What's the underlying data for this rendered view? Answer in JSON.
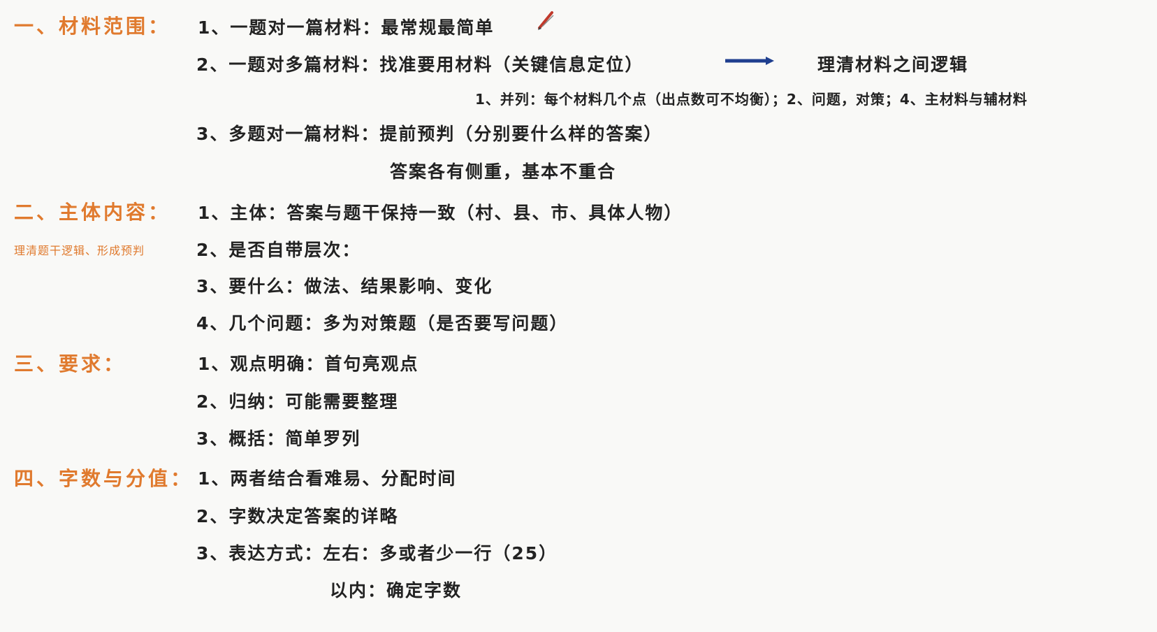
{
  "section1": {
    "heading": "一、材料范围：",
    "item1": "1、一题对一篇材料：最常规最简单",
    "item2": "2、一题对多篇材料：找准要用材料（关键信息定位）",
    "item2_result": "理清材料之间逻辑",
    "item2_sub": "1、并列：每个材料几个点（出点数可不均衡）；2、问题，对策；4、主材料与辅材料",
    "item3": "3、多题对一篇材料：提前预判（分别要什么样的答案）",
    "item3_sub": "答案各有侧重，基本不重合"
  },
  "section2": {
    "heading": "二、主体内容：",
    "note": "理清题干逻辑、形成预判",
    "item1": "1、主体：答案与题干保持一致（村、县、市、具体人物）",
    "item2": "2、是否自带层次：",
    "item3": "3、要什么：做法、结果影响、变化",
    "item4": "4、几个问题：多为对策题（是否要写问题）"
  },
  "section3": {
    "heading": "三、要求：",
    "item1": "1、观点明确：首句亮观点",
    "item2": "2、归纳：可能需要整理",
    "item3": "3、概括：简单罗列"
  },
  "section4": {
    "heading": "四、字数与分值：",
    "item1": "1、两者结合看难易、分配时间",
    "item2": "2、字数决定答案的详略",
    "item3": "3、表达方式：左右：多或者少一行（25）",
    "item3_sub": "以内：确定字数"
  },
  "colors": {
    "heading": "#e07a2e",
    "text": "#222222",
    "arrow": "#1f3f8f",
    "pen": "#c0392b"
  }
}
